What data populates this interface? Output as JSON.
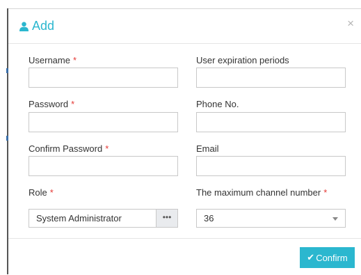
{
  "dialog": {
    "title": "Add",
    "close": "×",
    "icon": "user-icon"
  },
  "form": {
    "required_mark": "*",
    "username": {
      "label": "Username",
      "value": ""
    },
    "user_expiration": {
      "label": "User expiration periods",
      "value": ""
    },
    "password": {
      "label": "Password",
      "value": ""
    },
    "phone": {
      "label": "Phone No.",
      "value": ""
    },
    "confirm_password": {
      "label": "Confirm Password",
      "value": ""
    },
    "email": {
      "label": "Email",
      "value": ""
    },
    "role": {
      "label": "Role",
      "value": "System Administrator",
      "button": "•••"
    },
    "max_channel": {
      "label": "The maximum channel number",
      "value": "36"
    }
  },
  "footer": {
    "confirm_label": "Confirm",
    "confirm_icon": "✔"
  },
  "colors": {
    "accent": "#2bb7cf",
    "required": "#e53935"
  }
}
